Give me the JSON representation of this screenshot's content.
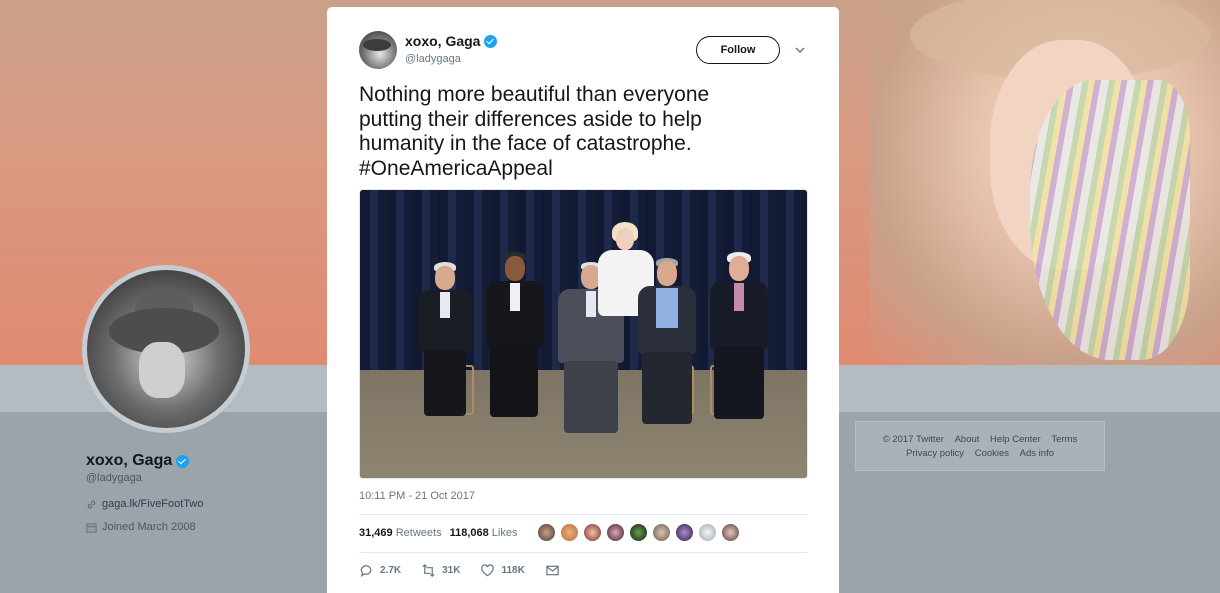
{
  "profile": {
    "name": "xoxo, Gaga",
    "handle": "@ladygaga",
    "website": "gaga.lk/FiveFootTwo",
    "joined": "Joined March 2008"
  },
  "footer": {
    "row1": [
      "© 2017 Twitter",
      "About",
      "Help Center",
      "Terms"
    ],
    "row2": [
      "Privacy policy",
      "Cookies",
      "Ads info"
    ]
  },
  "tweet": {
    "author_name": "xoxo, Gaga",
    "author_handle": "@ladygaga",
    "follow_label": "Follow",
    "text_lines": [
      "Nothing more beautiful than everyone",
      "putting their differences aside to help",
      "humanity in the face of catastrophe.",
      "#OneAmericaAppeal"
    ],
    "timestamp": "10:11 PM - 21 Oct 2017",
    "retweets_count": "31,469",
    "retweets_label": "Retweets",
    "likes_count": "118,068",
    "likes_label": "Likes",
    "actions": {
      "reply_count": "2.7K",
      "retweet_count": "31K",
      "like_count": "118K"
    }
  },
  "colors": {
    "accent": "#1da1f2",
    "text": "#14171a",
    "muted": "#657786"
  },
  "icons": [
    "verified-badge-icon",
    "chevron-down-icon",
    "link-icon",
    "calendar-icon",
    "reply-icon",
    "retweet-icon",
    "heart-icon",
    "direct-message-icon"
  ]
}
